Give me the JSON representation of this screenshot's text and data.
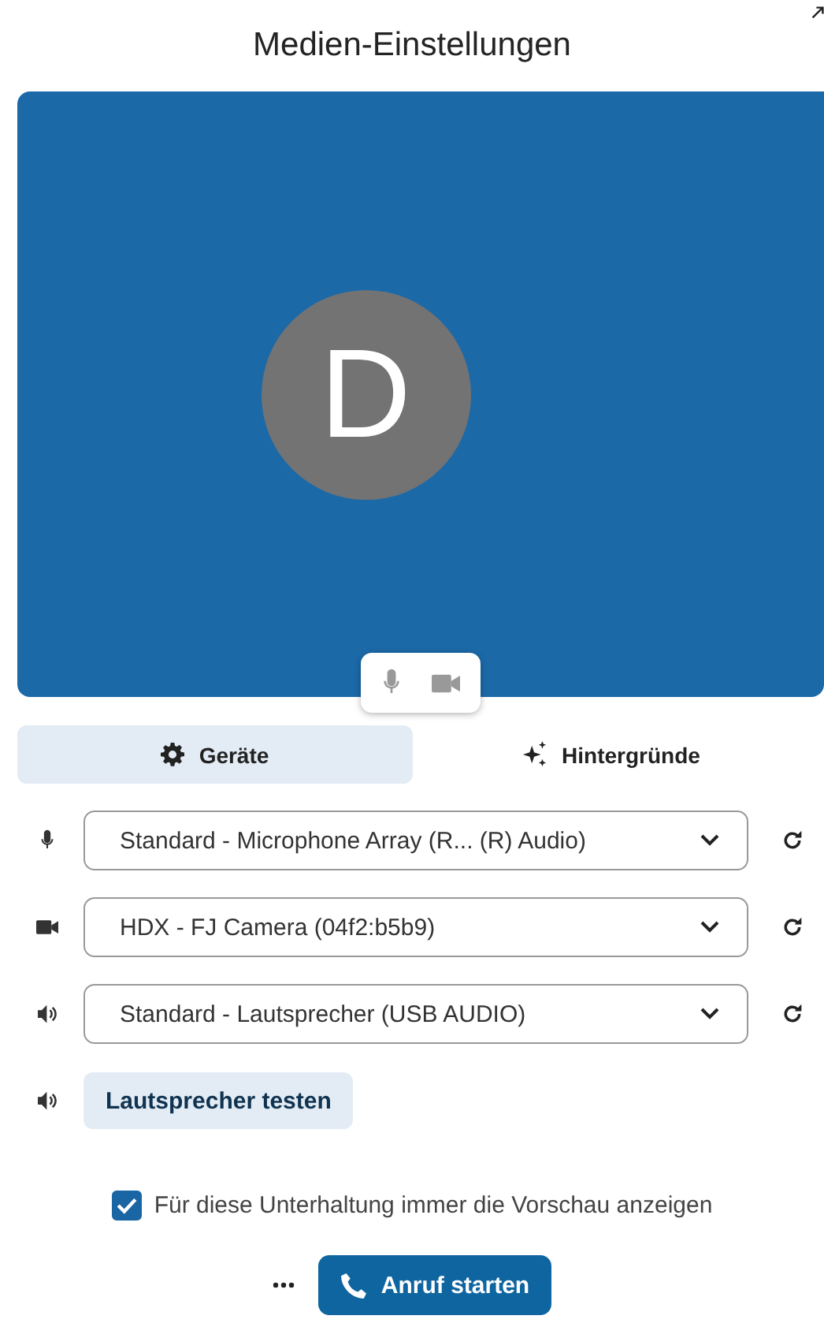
{
  "window": {
    "title": "Medien-Einstellungen"
  },
  "preview": {
    "avatar_letter": "D"
  },
  "tabs": [
    {
      "label": "Geräte",
      "kind": "devices",
      "selected": true
    },
    {
      "label": "Hintergründe",
      "kind": "backgrounds",
      "selected": false
    }
  ],
  "devices": [
    {
      "kind": "microphone",
      "value": "Standard - Microphone Array (R... (R) Audio)"
    },
    {
      "kind": "camera",
      "value": "HDX - FJ Camera (04f2:b5b9)"
    },
    {
      "kind": "speaker",
      "value": "Standard - Lautsprecher (USB AUDIO)"
    }
  ],
  "test_button": {
    "label": "Lautsprecher testen"
  },
  "preview_option": {
    "label": "Für diese Unterhaltung immer die Vorschau anzeigen",
    "checked": true
  },
  "call_button": {
    "label": "Anruf starten"
  }
}
